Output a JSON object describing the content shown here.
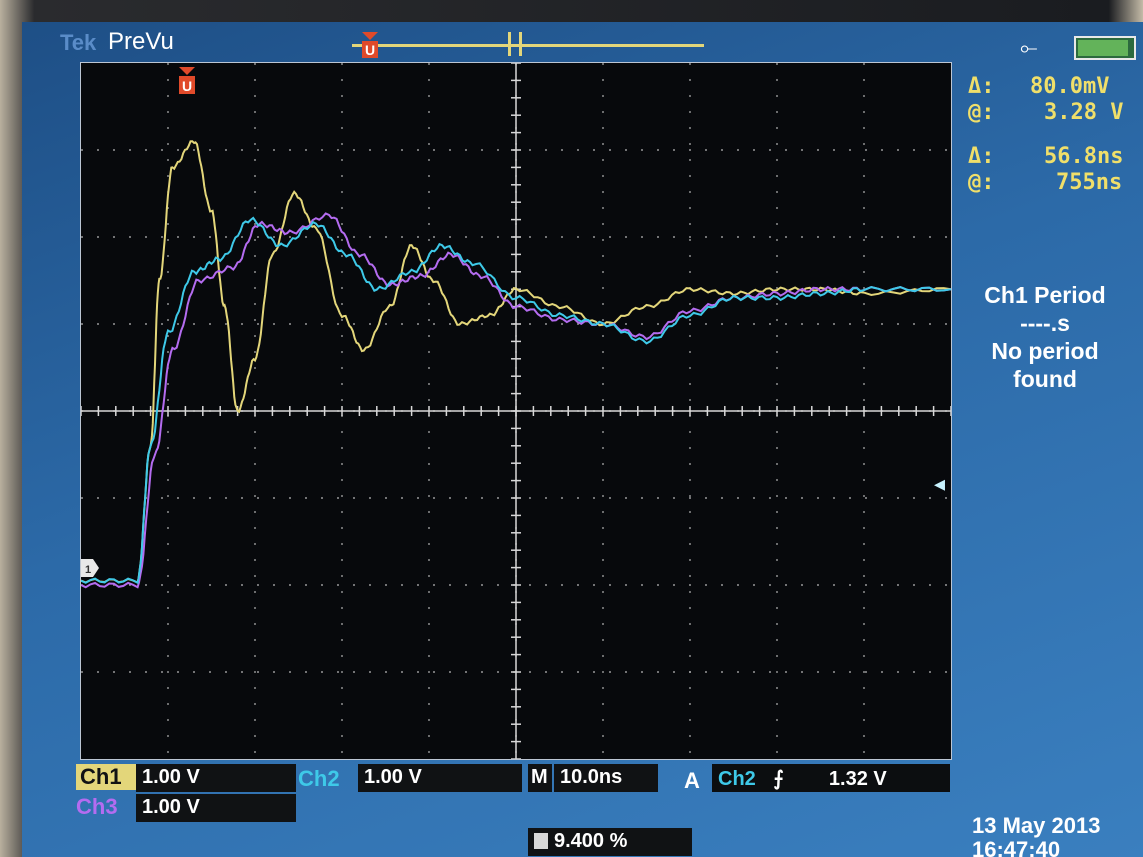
{
  "header": {
    "brand": "Tek",
    "mode": "PreVu"
  },
  "measurements": {
    "volt_delta_symbol": "Δ:",
    "volt_delta": "80.0mV",
    "volt_at_symbol": "@:",
    "volt_at": "3.28 V",
    "time_delta_symbol": "Δ:",
    "time_delta": "56.8ns",
    "time_at_symbol": "@:",
    "time_at": "755ns"
  },
  "period": {
    "title": "Ch1 Period",
    "value": "----.s",
    "line1": "No period",
    "line2": "found"
  },
  "channels": {
    "ch1_label": "Ch1",
    "ch1_scale": "1.00 V",
    "ch2_label": "Ch2",
    "ch2_scale": "1.00 V",
    "ch3_label": "Ch3",
    "ch3_scale": "1.00 V"
  },
  "timebase": {
    "m_label": "M",
    "value": "10.0ns"
  },
  "trigger": {
    "a_label": "A",
    "source": "Ch2",
    "slope_icon": "rising-edge-icon",
    "level": "1.32 V"
  },
  "footer": {
    "percent": "9.400 %",
    "date": "13 May 2013",
    "time": "16:47:40"
  },
  "colors": {
    "ch1": "#e3d67a",
    "ch2": "#3ec9e8",
    "ch3": "#b46cf0"
  }
}
